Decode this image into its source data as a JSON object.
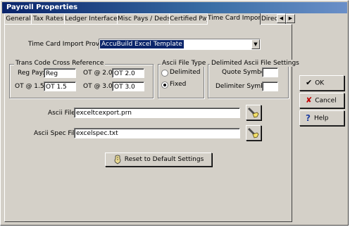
{
  "window": {
    "title": "Payroll Properties"
  },
  "tabs": [
    {
      "label": "General"
    },
    {
      "label": "Tax Rates"
    },
    {
      "label": "Ledger Interface"
    },
    {
      "label": "Misc Pays / Deds"
    },
    {
      "label": "Certified Payroll"
    },
    {
      "label": "Time Card Import"
    },
    {
      "label": "Direct D"
    }
  ],
  "provider": {
    "label": "Time Card Import Provider:",
    "value": "AccuBuild Excel Template"
  },
  "trans_code": {
    "title": "Trans Code Cross Reference",
    "reg_pay_label": "Reg Pay:",
    "reg_pay_value": "Reg",
    "ot15_label": "OT @ 1.5:",
    "ot15_value": "OT 1.5",
    "ot20_label": "OT @ 2.0:",
    "ot20_value": "OT 2.0",
    "ot30_label": "OT @ 3.0:",
    "ot30_value": "OT 3.0"
  },
  "file_type": {
    "title": "Ascii File Type",
    "delimited_label": "Delimited",
    "fixed_label": "Fixed",
    "selected": "Fixed"
  },
  "delimited_settings": {
    "title": "Delimited Ascii File Settings",
    "quote_label": "Quote Symbol:",
    "quote_value": "",
    "delimiter_label": "Delimiter Symbol:",
    "delimiter_value": ""
  },
  "ascii_file": {
    "label": "Ascii File:",
    "value": "exceltcexport.prn"
  },
  "ascii_spec_file": {
    "label": "Ascii Spec File:",
    "value": "excelspec.txt"
  },
  "reset_button": {
    "label": "Reset to Default Settings"
  },
  "side_buttons": {
    "ok": "OK",
    "cancel": "Cancel",
    "help": "Help"
  }
}
